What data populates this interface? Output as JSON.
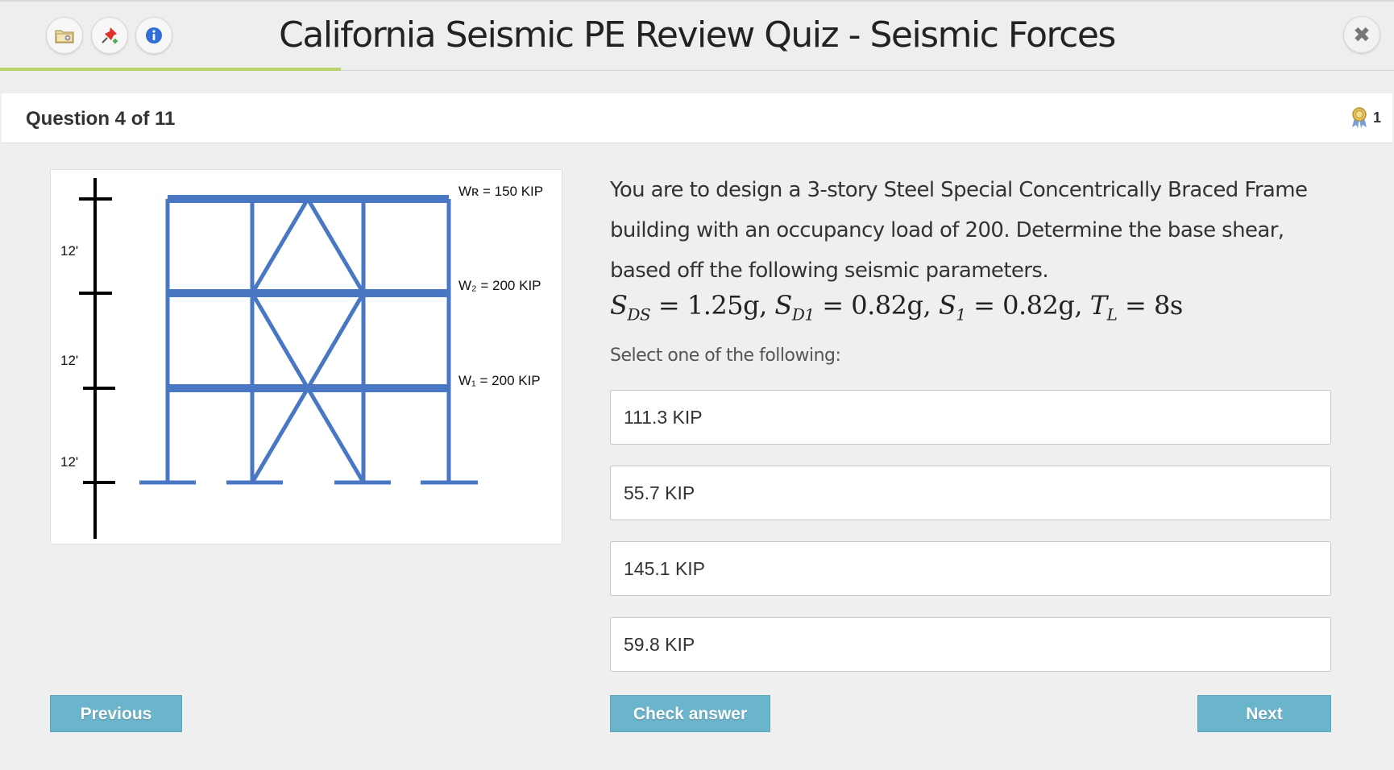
{
  "header": {
    "title": "California Seismic PE Review Quiz - Seismic Forces",
    "buttons": [
      {
        "icon": "folder-icon"
      },
      {
        "icon": "pin-icon"
      },
      {
        "icon": "info-icon"
      }
    ],
    "close_label": "✖",
    "progress_fraction": 0.2443
  },
  "question": {
    "counter": "Question 4 of 11",
    "points": "1",
    "text": "You are to design a 3-story Steel Special Concentrically Braced Frame building with an occupancy load of 200. Determine the base shear, based off the following seismic parameters.",
    "hint": "Select one of the following:",
    "formula": {
      "sds_label": "S",
      "sds_sub": "DS",
      "sds_val": " = 1.25g, ",
      "sd1_label": "S",
      "sd1_sub": "D1",
      "sd1_val": " = 0.82g, ",
      "s1_label": "S",
      "s1_sub": "1",
      "s1_val": " = 0.82g, ",
      "tl_label": "T",
      "tl_sub": "L",
      "tl_val": " = 8s"
    }
  },
  "figure": {
    "story_height_labels": [
      "12'",
      "12'",
      "12'"
    ],
    "weights": {
      "wr": "Wʀ = 150 KIP",
      "w2": "W₂ = 200 KIP",
      "w1": "W₁ = 200 KIP"
    },
    "frame_color": "#4a77c4"
  },
  "options": [
    "111.3 KIP",
    "55.7 KIP",
    "145.1 KIP",
    "59.8 KIP"
  ],
  "buttons": {
    "previous": "Previous",
    "check": "Check answer",
    "next": "Next"
  },
  "colors": {
    "button_bg": "#6ab4cc",
    "progress": "#b8d36a"
  }
}
